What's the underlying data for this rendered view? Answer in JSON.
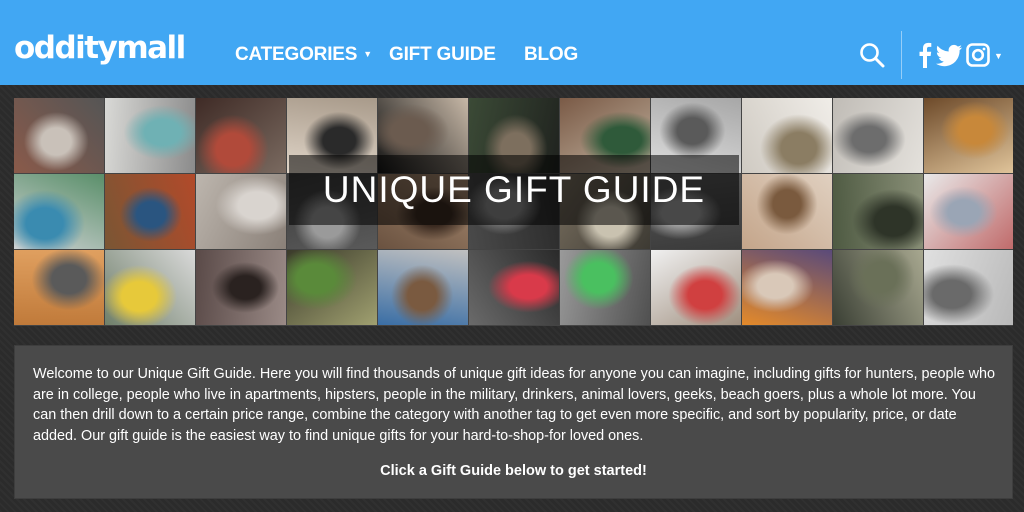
{
  "header": {
    "logo": "odditymall",
    "nav": {
      "categories": "CATEGORIES",
      "gift_guide": "GIFT GUIDE",
      "blog": "BLOG"
    },
    "icons": [
      "search-icon",
      "facebook-icon",
      "twitter-icon",
      "instagram-icon",
      "chevron-down-icon"
    ],
    "brand_color": "#41a7f3"
  },
  "banner": {
    "title": "UNIQUE GIFT GUIDE"
  },
  "intro": {
    "text": "Welcome to our Unique Gift Guide. Here you will find thousands of unique gift ideas for anyone you can imagine, including gifts for hunters, people who are in college, people who live in apartments, hipsters, people in the military, drinkers, animal lovers, geeks, beach goers, plus a whole lot more. You can then drill down to a certain price range, combine the category with another tag to get even more specific, and sort by popularity, price, or date added. Our gift guide is the easiest way to find unique gifts for your hard-to-shop-for loved ones.",
    "cta": "Click a Gift Guide below to get started!"
  }
}
